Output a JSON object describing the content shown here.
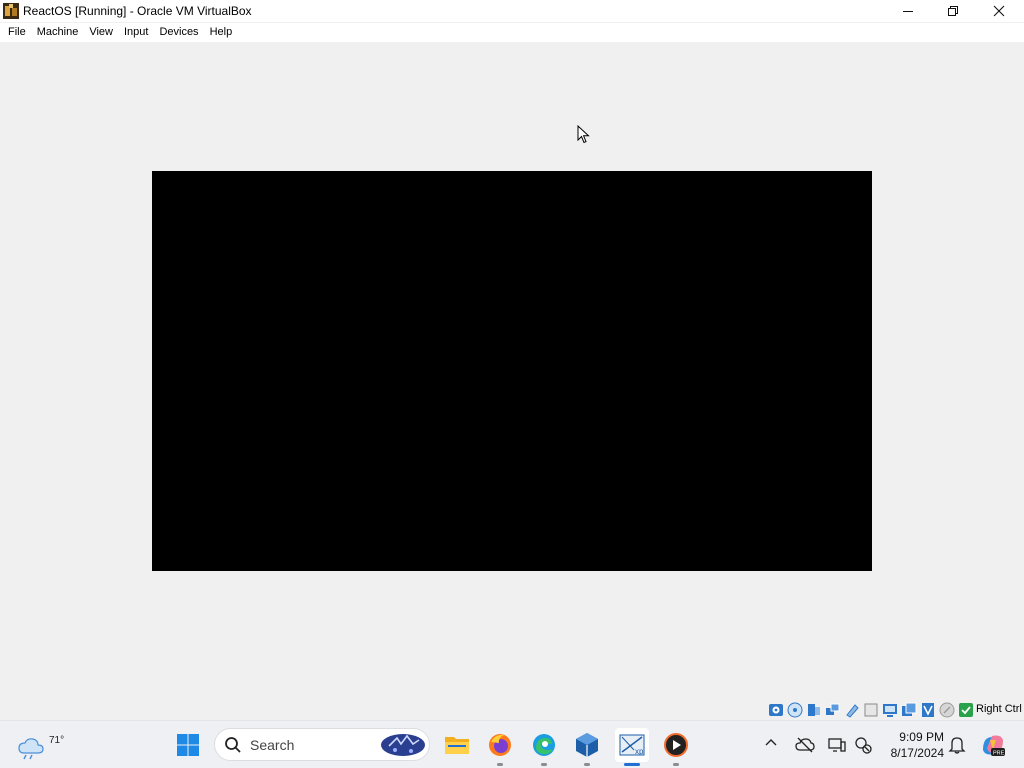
{
  "window": {
    "title": "ReactOS [Running] - Oracle VM VirtualBox",
    "controls": {
      "minimize": "minimize-icon",
      "maximize": "restore-icon",
      "close": "close-icon"
    }
  },
  "menubar": {
    "items": [
      {
        "label": "File"
      },
      {
        "label": "Machine"
      },
      {
        "label": "View"
      },
      {
        "label": "Input"
      },
      {
        "label": "Devices"
      },
      {
        "label": "Help"
      }
    ]
  },
  "vm_display": {
    "background": "#000000"
  },
  "statusbar": {
    "icons": [
      "hard-disk-icon",
      "optical-drive-icon",
      "audio-icon",
      "network-icon",
      "usb-icon",
      "shared-folders-icon",
      "display-icon",
      "video-capture-icon",
      "cpu-icon",
      "mouse-integration-icon",
      "keyboard-capture-icon"
    ],
    "host_key": "Right Ctrl"
  },
  "taskbar": {
    "weather": {
      "temperature": "71°"
    },
    "search": {
      "placeholder": "Search"
    },
    "apps": [
      {
        "name": "file-explorer",
        "running": false
      },
      {
        "name": "firefox",
        "running": true
      },
      {
        "name": "edge",
        "running": true
      },
      {
        "name": "virtualbox",
        "running": true
      },
      {
        "name": "virtualbox-vm-xp",
        "running": true,
        "active": true
      },
      {
        "name": "media-player",
        "running": true
      }
    ],
    "tray": {
      "time": "9:09 PM",
      "date": "8/17/2024"
    }
  },
  "colors": {
    "window_bg": "#f0f0f0",
    "taskbar_bg": "#eef0f3",
    "accent": "#1f6fd4"
  }
}
